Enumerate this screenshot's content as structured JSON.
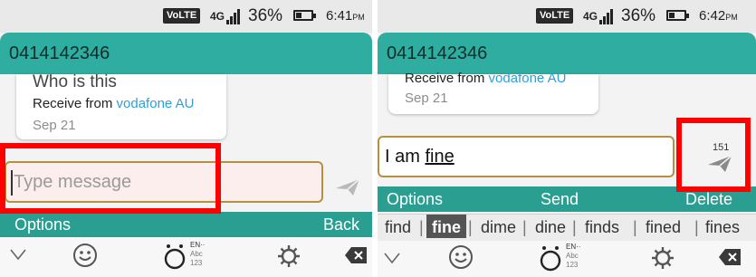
{
  "left": {
    "status": {
      "volte": "VoLTE",
      "network": "4G",
      "battery": "36%",
      "time": "6:41",
      "ampm": "PM"
    },
    "header": {
      "number": "0414142346"
    },
    "message": {
      "question": "Who is this",
      "receive_prefix": "Receive from ",
      "operator": "vodafone AU",
      "date": "Sep 21"
    },
    "input": {
      "placeholder": "Type message"
    },
    "options_bar": {
      "options": "Options",
      "back": "Back"
    },
    "keyboard": {
      "lang_line1": "EN··",
      "lang_line2": "Abc",
      "lang_line3": "123"
    }
  },
  "right": {
    "status": {
      "volte": "VoLTE",
      "network": "4G",
      "battery": "36%",
      "time": "6:42",
      "ampm": "PM"
    },
    "header": {
      "number": "0414142346"
    },
    "message": {
      "receive_prefix": "Receive from ",
      "operator": "vodafone AU",
      "date": "Sep 21"
    },
    "input": {
      "value_prefix": "I am ",
      "value_word": "fine"
    },
    "char_counter": "151",
    "options_bar": {
      "options": "Options",
      "send": "Send",
      "delete": "Delete"
    },
    "suggestions": [
      "find",
      "fine",
      "dime",
      "dine",
      "finds",
      "fined",
      "fines"
    ],
    "selected_suggestion": "fine",
    "keyboard": {
      "lang_line1": "EN··",
      "lang_line2": "Abc",
      "lang_line3": "123"
    }
  },
  "colors": {
    "header": "#2fada0",
    "options_bar": "#2a9e91",
    "input_border": "#b5913f",
    "highlight_box": "#ff0000",
    "operator_link": "#2e9fd8"
  },
  "icons": [
    "chevron-down-icon",
    "emoji-icon",
    "input-mode-icon",
    "settings-gear-icon",
    "backspace-icon",
    "send-icon"
  ]
}
